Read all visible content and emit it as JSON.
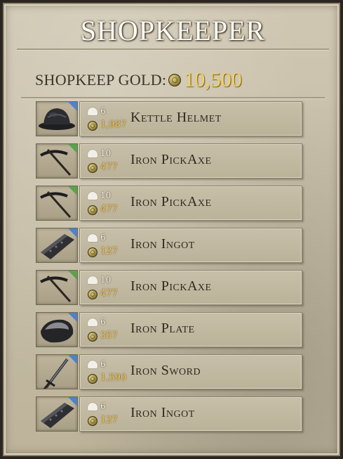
{
  "title": "SHOPKEEPER",
  "shopkeep": {
    "gold_label": "SHOPKEEP GOLD:",
    "gold_value": "10,500"
  },
  "items": [
    {
      "name": "Kettle Helmet",
      "weight": "6",
      "price": "1,987",
      "icon": "helmet-icon",
      "tag_color": "#4f82c9"
    },
    {
      "name": "Iron PickAxe",
      "weight": "10",
      "price": "477",
      "icon": "pickaxe-icon",
      "tag_color": "#5aa34d"
    },
    {
      "name": "Iron PickAxe",
      "weight": "10",
      "price": "477",
      "icon": "pickaxe-icon",
      "tag_color": "#5aa34d"
    },
    {
      "name": "Iron Ingot",
      "weight": "6",
      "price": "127",
      "icon": "ingot-icon",
      "tag_color": "#4f82c9"
    },
    {
      "name": "Iron PickAxe",
      "weight": "10",
      "price": "477",
      "icon": "pickaxe-icon",
      "tag_color": "#5aa34d"
    },
    {
      "name": "Iron Plate",
      "weight": "6",
      "price": "357",
      "icon": "plate-icon",
      "tag_color": "#4f82c9"
    },
    {
      "name": "Iron Sword",
      "weight": "6",
      "price": "1,590",
      "icon": "sword-icon",
      "tag_color": "#4f82c9"
    },
    {
      "name": "Iron Ingot",
      "weight": "6",
      "price": "127",
      "icon": "ingot-icon",
      "tag_color": "#4f82c9"
    }
  ]
}
